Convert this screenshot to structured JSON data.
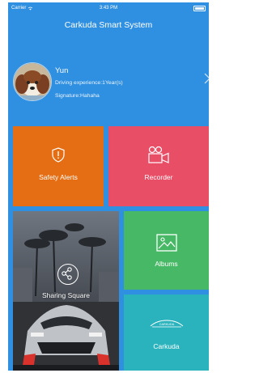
{
  "status_bar": {
    "carrier": "Carrier",
    "time": "3:43 PM"
  },
  "header": {
    "title": "Carkuda Smart System"
  },
  "profile": {
    "name": "Yun",
    "driving_experience": "Driving experience:1Year(s)",
    "signature": "Signature:Hahaha",
    "avatar_icon": "puppy-avatar"
  },
  "tiles": {
    "safety_alerts": {
      "label": "Safety Alerts",
      "icon": "shield-alert-icon",
      "color": "#e56d13"
    },
    "recorder": {
      "label": "Recorder",
      "icon": "video-camera-icon",
      "color": "#e94e67"
    },
    "sharing_square": {
      "label": "Sharing Square",
      "icon": "share-icon"
    },
    "albums": {
      "label": "Albums",
      "icon": "image-icon",
      "color": "#47b865"
    },
    "carkuda": {
      "label": "Carkuda",
      "logo_text": "CARKUDA",
      "color": "#2bb3bd"
    }
  },
  "colors": {
    "background": "#2f8fe0",
    "text": "#ffffff"
  }
}
